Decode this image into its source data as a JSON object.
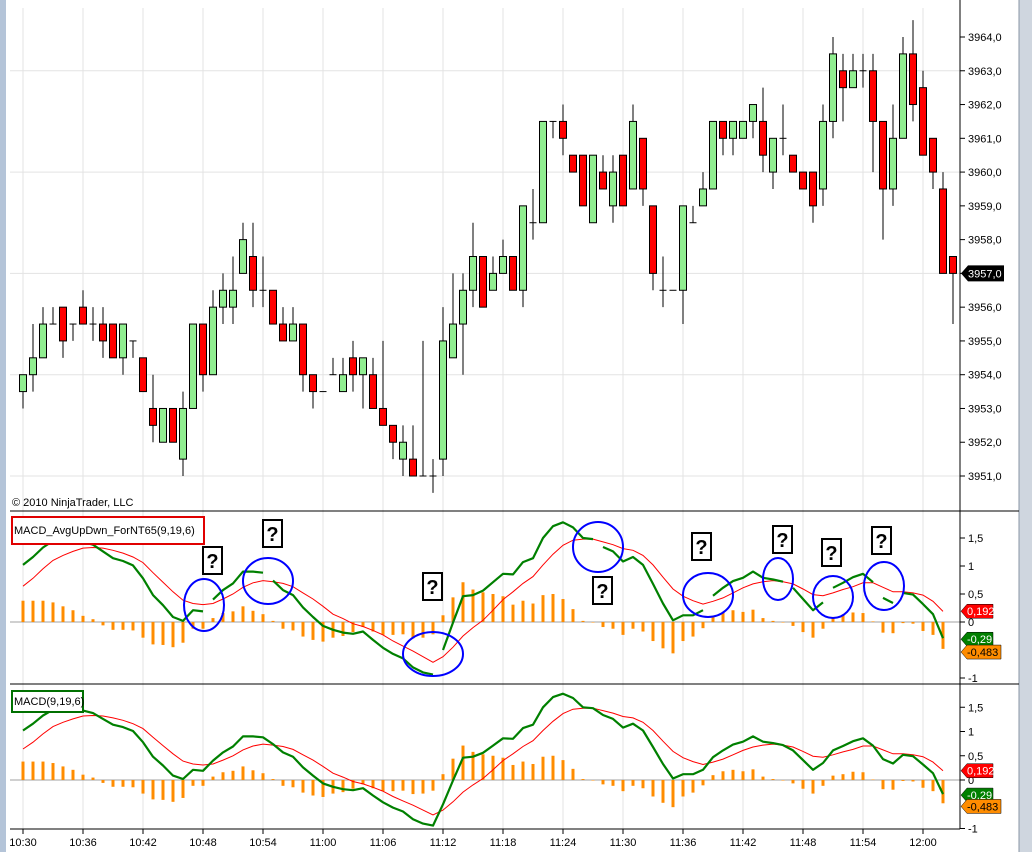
{
  "copyright": "© 2010 NinjaTrader, LLC",
  "colors": {
    "up_candle": "#90EE90",
    "down_candle": "#FF0000",
    "macd_line": "#008000",
    "signal_line": "#FF0000",
    "histogram": "#FF8C00",
    "annotation_circle": "#0000FF",
    "price_tag": "#000000"
  },
  "price_axis": {
    "ticks": [
      "3964,0",
      "3963,0",
      "3962,0",
      "3961,0",
      "3960,0",
      "3959,0",
      "3958,0",
      "3957,0",
      "3956,0",
      "3955,0",
      "3954,0",
      "3953,0",
      "3952,0",
      "3951,0"
    ],
    "current_price_label": "3957,0"
  },
  "time_axis": {
    "ticks": [
      "10:30",
      "10:36",
      "10:42",
      "10:48",
      "10:54",
      "11:00",
      "11:06",
      "11:12",
      "11:18",
      "11:24",
      "11:30",
      "11:36",
      "11:42",
      "11:48",
      "11:54",
      "12:00"
    ]
  },
  "panels": {
    "indicator1": {
      "title": "MACD_AvgUpDwn_ForNT65(9,19,6)",
      "ticks": [
        "1,5",
        "1",
        "0,5",
        "0",
        "-1"
      ],
      "tags": {
        "signal": "0,192",
        "macd": "-0,29",
        "histogram": "-0,483"
      },
      "question_marks": [
        "?",
        "?",
        "?",
        "?",
        "?",
        "?",
        "?",
        "?"
      ]
    },
    "indicator2": {
      "title": "MACD(9,19,6)",
      "ticks": [
        "1,5",
        "1",
        "0,5",
        "0",
        "-1"
      ],
      "tags": {
        "signal": "0,192",
        "macd": "-0,29",
        "histogram": "-0,483"
      }
    }
  },
  "chart_data": [
    {
      "type": "candlestick",
      "x_start": "10:30",
      "interval": "1 minute",
      "ylim": [
        3950.3,
        3965
      ],
      "grid": true,
      "ohlc": [
        [
          3953.5,
          3954,
          3953,
          3954
        ],
        [
          3954,
          3955.5,
          3953.5,
          3954.5
        ],
        [
          3954.5,
          3956,
          3954.5,
          3955.5
        ],
        [
          3955.5,
          3956,
          3955.5,
          3955.5
        ],
        [
          3956,
          3956,
          3954.5,
          3955
        ],
        [
          3955.5,
          3955.5,
          3955,
          3955.5
        ],
        [
          3956,
          3956.5,
          3955.5,
          3955.5
        ],
        [
          3955.5,
          3956,
          3955,
          3955.5
        ],
        [
          3955.5,
          3956,
          3954.5,
          3955
        ],
        [
          3955.5,
          3955.5,
          3954.5,
          3954.5
        ],
        [
          3954.5,
          3955.5,
          3954,
          3955.5
        ],
        [
          3955,
          3955,
          3954.5,
          3955
        ],
        [
          3954.5,
          3954.5,
          3953.5,
          3953.5
        ],
        [
          3953,
          3954,
          3952,
          3952.5
        ],
        [
          3952,
          3953,
          3952,
          3953
        ],
        [
          3953,
          3953,
          3952,
          3952
        ],
        [
          3951.5,
          3953.5,
          3951,
          3953
        ],
        [
          3953,
          3955.5,
          3953,
          3955.5
        ],
        [
          3955.5,
          3955.5,
          3953.5,
          3954
        ],
        [
          3954,
          3956.5,
          3954,
          3956
        ],
        [
          3956,
          3957,
          3955.5,
          3956.5
        ],
        [
          3956,
          3957.5,
          3955.5,
          3956.5
        ],
        [
          3957,
          3958.5,
          3957,
          3958
        ],
        [
          3957.5,
          3958.5,
          3956,
          3956.5
        ],
        [
          3956.5,
          3957.5,
          3956,
          3956.5
        ],
        [
          3956.5,
          3956.5,
          3955.5,
          3955.5
        ],
        [
          3955.5,
          3956,
          3955,
          3955
        ],
        [
          3955,
          3956,
          3955,
          3955.5
        ],
        [
          3955.5,
          3955.5,
          3953.5,
          3954
        ],
        [
          3954,
          3954,
          3953,
          3953.5
        ],
        [
          3953.5,
          3953.5,
          3953.5,
          3953.5
        ],
        [
          3954,
          3954.5,
          3954,
          3954
        ],
        [
          3953.5,
          3954.5,
          3953.5,
          3954
        ],
        [
          3954.5,
          3955,
          3953.5,
          3954
        ],
        [
          3954,
          3954.5,
          3953,
          3954.5
        ],
        [
          3954,
          3954.5,
          3953,
          3953
        ],
        [
          3953,
          3955,
          3952.5,
          3952.5
        ],
        [
          3952.5,
          3952.5,
          3951.5,
          3952
        ],
        [
          3951.5,
          3952.5,
          3951,
          3952
        ],
        [
          3951.5,
          3952.5,
          3951,
          3951
        ],
        [
          3951,
          3955,
          3951,
          3951
        ],
        [
          3951,
          3951.5,
          3950.5,
          3951
        ],
        [
          3951.5,
          3956,
          3951,
          3955
        ],
        [
          3954.5,
          3957,
          3954.5,
          3955.5
        ],
        [
          3955.5,
          3957,
          3954,
          3956.5
        ],
        [
          3956.5,
          3958.5,
          3956,
          3957.5
        ],
        [
          3957.5,
          3957.5,
          3956,
          3956
        ],
        [
          3956.5,
          3957.5,
          3956.5,
          3957
        ],
        [
          3957,
          3958,
          3957,
          3957.5
        ],
        [
          3957.5,
          3957.5,
          3956.5,
          3956.5
        ],
        [
          3956.5,
          3959,
          3956,
          3959
        ],
        [
          3958.5,
          3959.5,
          3958,
          3958.5
        ],
        [
          3958.5,
          3961.5,
          3958.5,
          3961.5
        ],
        [
          3961.5,
          3961.5,
          3961,
          3961.5
        ],
        [
          3961.5,
          3962,
          3960.5,
          3961
        ],
        [
          3960.5,
          3960.5,
          3960,
          3960
        ],
        [
          3960.5,
          3960.5,
          3959,
          3959
        ],
        [
          3958.5,
          3960.5,
          3958.5,
          3960.5
        ],
        [
          3960,
          3960.5,
          3959.5,
          3959.5
        ],
        [
          3959,
          3960.5,
          3958.5,
          3960
        ],
        [
          3960.5,
          3960.5,
          3959,
          3959
        ],
        [
          3959.5,
          3962,
          3959.5,
          3961.5
        ],
        [
          3961,
          3961,
          3959,
          3959.5
        ],
        [
          3959,
          3959,
          3956.5,
          3957
        ],
        [
          3956.5,
          3957.5,
          3956,
          3956.5
        ],
        [
          3956.5,
          3956.5,
          3956.5,
          3956.5
        ],
        [
          3956.5,
          3959,
          3955.5,
          3959
        ],
        [
          3958.5,
          3959,
          3958.5,
          3958.5
        ],
        [
          3959,
          3960,
          3959,
          3959.5
        ],
        [
          3959.5,
          3961.5,
          3959.5,
          3961.5
        ],
        [
          3961.5,
          3961.5,
          3960.5,
          3961
        ],
        [
          3961,
          3961.5,
          3960.5,
          3961.5
        ],
        [
          3961,
          3961.5,
          3961,
          3961.5
        ],
        [
          3961.5,
          3962,
          3961,
          3962
        ],
        [
          3961.5,
          3962.5,
          3960,
          3960.5
        ],
        [
          3960,
          3961,
          3959.5,
          3961
        ],
        [
          3961,
          3962,
          3960.5,
          3961
        ],
        [
          3960.5,
          3960.5,
          3960,
          3960
        ],
        [
          3960,
          3960,
          3959.5,
          3959.5
        ],
        [
          3960,
          3960,
          3958.5,
          3959
        ],
        [
          3959.5,
          3962,
          3959,
          3961.5
        ],
        [
          3961.5,
          3964,
          3961,
          3963.5
        ],
        [
          3963,
          3963.5,
          3961.5,
          3962.5
        ],
        [
          3962.5,
          3963.5,
          3962.5,
          3963
        ],
        [
          3963,
          3963.5,
          3962.5,
          3963
        ],
        [
          3963,
          3963.5,
          3960,
          3961.5
        ],
        [
          3961.5,
          3961.5,
          3958,
          3959.5
        ],
        [
          3959.5,
          3962,
          3959,
          3961
        ],
        [
          3961,
          3964,
          3961,
          3963.5
        ],
        [
          3963.5,
          3964.5,
          3961.5,
          3962
        ],
        [
          3962.5,
          3963,
          3960.5,
          3960.5
        ],
        [
          3961,
          3961,
          3959.5,
          3960
        ],
        [
          3959.5,
          3960,
          3957,
          3957
        ],
        [
          3957.5,
          3957.5,
          3955.5,
          3957
        ]
      ]
    },
    {
      "type": "line",
      "panel": "MACD_AvgUpDwn_ForNT65(9,19,6)",
      "ylim": [
        -1.05,
        1.95
      ],
      "macd_gaps_after": [
        18,
        24,
        41,
        57,
        68,
        76,
        80,
        85,
        87
      ],
      "uses_series_of": "MACD(9,19,6)"
    },
    {
      "type": "line",
      "panel": "MACD(9,19,6)",
      "ylim": [
        -1.05,
        1.95
      ],
      "macd": [
        1.02,
        1.16,
        1.33,
        1.45,
        1.47,
        1.47,
        1.43,
        1.38,
        1.26,
        1.14,
        1.09,
        1.01,
        0.78,
        0.48,
        0.3,
        0.09,
        0.02,
        0.21,
        0.19,
        0.4,
        0.57,
        0.69,
        0.9,
        0.9,
        0.88,
        0.74,
        0.57,
        0.48,
        0.26,
        0.09,
        -0.07,
        -0.14,
        -0.19,
        -0.21,
        -0.17,
        -0.32,
        -0.46,
        -0.57,
        -0.65,
        -0.81,
        -0.9,
        -0.94,
        -0.5,
        -0.01,
        0.46,
        0.48,
        0.56,
        0.71,
        0.86,
        0.85,
        1.07,
        1.14,
        1.5,
        1.71,
        1.78,
        1.69,
        1.5,
        1.48,
        1.34,
        1.26,
        1.08,
        1.16,
        1.02,
        0.68,
        0.33,
        0.03,
        0.12,
        0.12,
        0.21,
        0.47,
        0.61,
        0.73,
        0.79,
        0.9,
        0.79,
        0.76,
        0.72,
        0.61,
        0.41,
        0.21,
        0.35,
        0.61,
        0.7,
        0.8,
        0.86,
        0.71,
        0.43,
        0.34,
        0.52,
        0.49,
        0.32,
        0.14,
        -0.29
      ],
      "signal": [
        0.64,
        0.78,
        0.95,
        1.1,
        1.19,
        1.26,
        1.32,
        1.33,
        1.32,
        1.28,
        1.23,
        1.16,
        1.06,
        0.88,
        0.71,
        0.54,
        0.39,
        0.33,
        0.31,
        0.33,
        0.41,
        0.5,
        0.62,
        0.7,
        0.74,
        0.72,
        0.69,
        0.63,
        0.52,
        0.41,
        0.28,
        0.14,
        0.06,
        -0.03,
        -0.08,
        -0.15,
        -0.23,
        -0.34,
        -0.43,
        -0.52,
        -0.62,
        -0.72,
        -0.62,
        -0.45,
        -0.25,
        -0.1,
        0.03,
        0.21,
        0.4,
        0.54,
        0.69,
        0.81,
        1.02,
        1.21,
        1.37,
        1.46,
        1.48,
        1.48,
        1.43,
        1.38,
        1.31,
        1.28,
        1.19,
        1.02,
        0.8,
        0.59,
        0.46,
        0.38,
        0.32,
        0.37,
        0.43,
        0.52,
        0.61,
        0.68,
        0.72,
        0.74,
        0.72,
        0.68,
        0.59,
        0.49,
        0.47,
        0.52,
        0.58,
        0.63,
        0.7,
        0.7,
        0.62,
        0.54,
        0.54,
        0.52,
        0.48,
        0.37,
        0.19
      ],
      "histogram": [
        0.38,
        0.38,
        0.38,
        0.35,
        0.28,
        0.21,
        0.11,
        0.05,
        -0.06,
        -0.14,
        -0.14,
        -0.15,
        -0.28,
        -0.4,
        -0.41,
        -0.45,
        -0.37,
        -0.12,
        -0.12,
        0.07,
        0.16,
        0.19,
        0.28,
        0.2,
        0.14,
        0.02,
        -0.12,
        -0.15,
        -0.26,
        -0.32,
        -0.35,
        -0.28,
        -0.25,
        -0.18,
        -0.09,
        -0.17,
        -0.23,
        -0.23,
        -0.22,
        -0.29,
        -0.28,
        -0.22,
        0.12,
        0.44,
        0.71,
        0.58,
        0.53,
        0.5,
        0.46,
        0.31,
        0.38,
        0.33,
        0.48,
        0.5,
        0.41,
        0.23,
        0.02,
        0.0,
        -0.09,
        -0.12,
        -0.23,
        -0.12,
        -0.17,
        -0.34,
        -0.47,
        -0.56,
        -0.34,
        -0.26,
        -0.11,
        0.1,
        0.18,
        0.21,
        0.18,
        0.22,
        0.07,
        0.02,
        0.0,
        -0.07,
        -0.18,
        -0.28,
        -0.12,
        0.09,
        0.12,
        0.17,
        0.16,
        0.01,
        -0.19,
        -0.2,
        -0.02,
        -0.03,
        -0.16,
        -0.23,
        -0.48
      ]
    }
  ]
}
